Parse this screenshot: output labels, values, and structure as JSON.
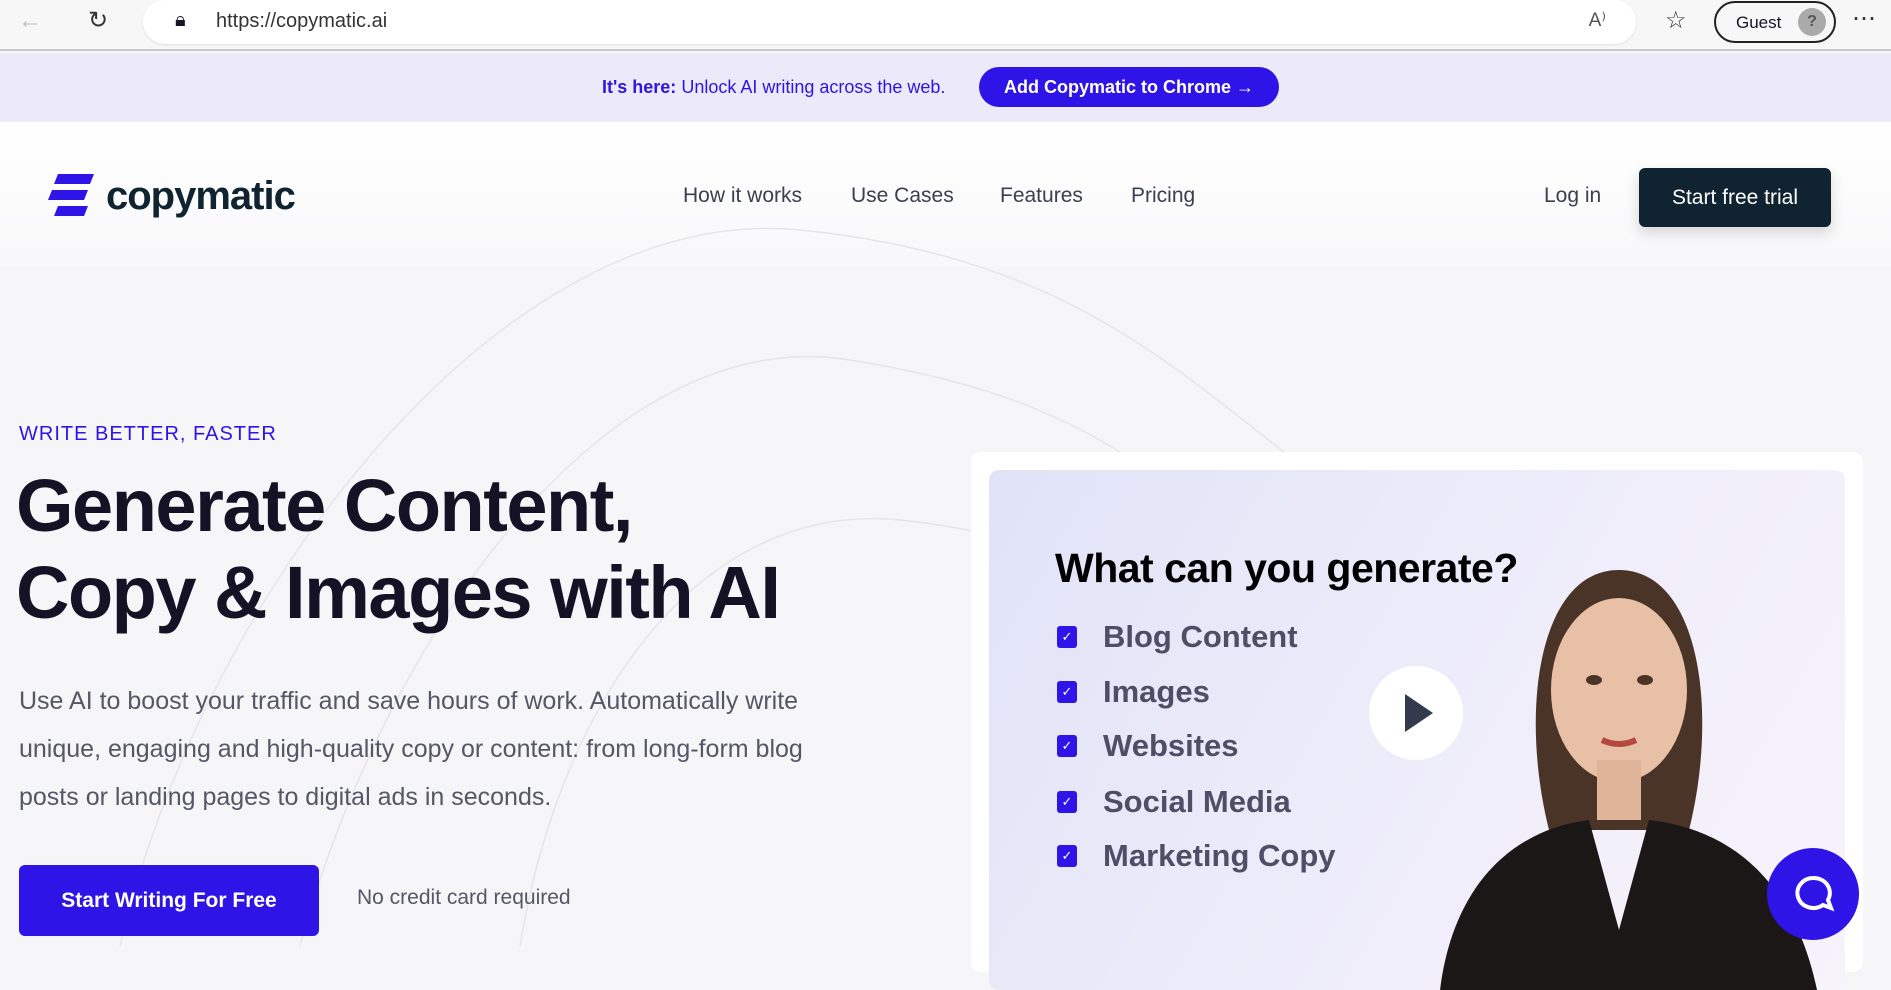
{
  "browser": {
    "url": "https://copymatic.ai",
    "profile": "Guest"
  },
  "banner": {
    "lead": "It's here:",
    "text": " Unlock AI writing across the web.",
    "button": "Add Copymatic to Chrome →"
  },
  "nav": {
    "logo": "copymatic",
    "links": [
      "How it works",
      "Use Cases",
      "Features",
      "Pricing"
    ],
    "login": "Log in",
    "trial": "Start free trial"
  },
  "hero": {
    "eyebrow": "WRITE BETTER, FASTER",
    "title_line1": "Generate Content,",
    "title_line2": "Copy & Images with AI",
    "paragraph": "Use AI to boost your traffic and save hours of work. Automatically write unique, engaging and high-quality copy or content: from long-form blog posts or landing pages to digital ads in seconds.",
    "cta": "Start Writing For Free",
    "note": "No credit card required"
  },
  "video": {
    "question": "What can you generate?",
    "items": [
      "Blog Content",
      "Images",
      "Websites",
      "Social Media",
      "Marketing Copy"
    ]
  },
  "colors": {
    "accent": "#2e14e6",
    "dark": "#102330"
  }
}
